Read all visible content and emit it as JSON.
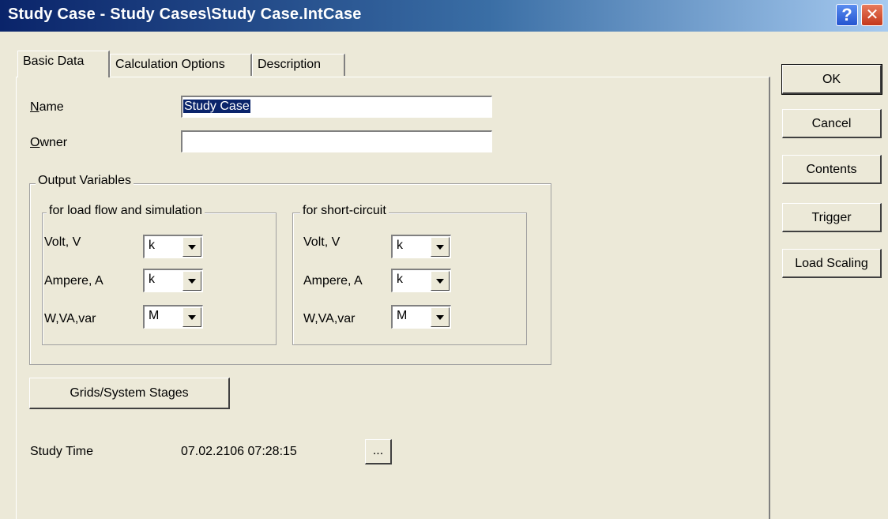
{
  "window": {
    "title": "Study Case - Study Cases\\Study Case.IntCase",
    "help_label": "?",
    "close_label": "✕"
  },
  "tabs": [
    {
      "label": "Basic Data",
      "active": true
    },
    {
      "label": "Calculation Options",
      "active": false
    },
    {
      "label": "Description",
      "active": false
    }
  ],
  "fields": {
    "name": {
      "label_accel": "N",
      "label_rest": "ame",
      "value": "Study Case"
    },
    "owner": {
      "label_accel": "O",
      "label_rest": "wner",
      "value": ""
    }
  },
  "output_variables": {
    "title": "Output Variables",
    "load_flow": {
      "title": "for load flow and simulation",
      "rows": [
        {
          "label": "Volt, V",
          "value": "k"
        },
        {
          "label": "Ampere, A",
          "value": "k"
        },
        {
          "label": "W,VA,var",
          "value": "M"
        }
      ]
    },
    "short_circuit": {
      "title": "for short-circuit",
      "rows": [
        {
          "label": "Volt, V",
          "value": "k"
        },
        {
          "label": "Ampere, A",
          "value": "k"
        },
        {
          "label": "W,VA,var",
          "value": "M"
        }
      ]
    }
  },
  "grids_button": "Grids/System Stages",
  "study_time": {
    "label": "Study Time",
    "value": "07.02.2106 07:28:15",
    "picker_label": "..."
  },
  "side_buttons": {
    "ok": "OK",
    "cancel": "Cancel",
    "contents": "Contents",
    "trigger": "Trigger",
    "load_scaling": "Load Scaling"
  },
  "colors": {
    "face": "#ece9d8",
    "title_gradient_start": "#0a246a",
    "title_gradient_end": "#a6caf0",
    "selection": "#0a246a"
  }
}
